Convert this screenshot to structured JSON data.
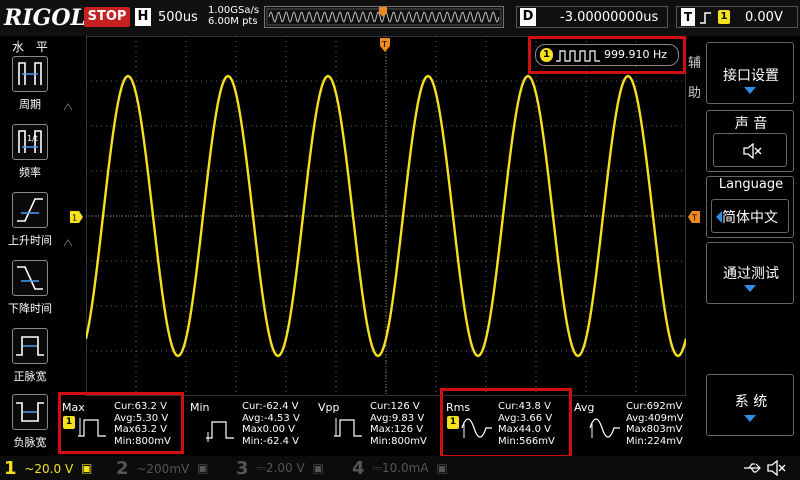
{
  "top": {
    "logo": "RIGOL",
    "run_state": "STOP",
    "horizontal_badge": "H",
    "timebase": "500us",
    "sample_rate": "1.00GSa/s",
    "memory_depth": "6.00M pts",
    "delay_badge": "D",
    "delay": "-3.00000000us",
    "trigger_badge": "T",
    "trigger_channel": "1",
    "trigger_level": "0.00V"
  },
  "left_menu": {
    "title": "水 平",
    "items": [
      {
        "label": "周期",
        "icon": "period-icon"
      },
      {
        "label": "频率",
        "icon": "frequency-icon"
      },
      {
        "label": "上升时间",
        "icon": "rise-time-icon"
      },
      {
        "label": "下降时间",
        "icon": "fall-time-icon"
      },
      {
        "label": "正脉宽",
        "icon": "positive-width-icon"
      },
      {
        "label": "负脉宽",
        "icon": "negative-width-icon"
      }
    ]
  },
  "frequency": {
    "channel": "1",
    "value": "999.910 Hz"
  },
  "right_menu": {
    "side_label_1": "辅",
    "side_label_2": "助",
    "interface": "接口设置",
    "sound_title": "声 音",
    "language_title": "Language",
    "language_value": "简体中文",
    "passfail": "通过测试",
    "system": "系 统"
  },
  "measurements": [
    {
      "name": "Max",
      "cur": "Cur:63.2 V",
      "avg": "Avg:5.30 V",
      "max": "Max63.2 V",
      "min": "Min:800mV"
    },
    {
      "name": "Min",
      "cur": "Cur:-62.4 V",
      "avg": "Avg:-4.53 V",
      "max": "Max0.00 V",
      "min": "Min:-62.4 V"
    },
    {
      "name": "Vpp",
      "cur": "Cur:126 V",
      "avg": "Avg:9.83 V",
      "max": "Max:126 V",
      "min": "Min:800mV"
    },
    {
      "name": "Rms",
      "cur": "Cur:43.8 V",
      "avg": "Avg:3.66 V",
      "max": "Max44.0 V",
      "min": "Min:566mV"
    },
    {
      "name": "Avg",
      "cur": "Cur:692mV",
      "avg": "Avg:409mV",
      "max": "Max803mV",
      "min": "Min:224mV"
    }
  ],
  "channels": [
    {
      "num": "1",
      "value": "~20.0 V"
    },
    {
      "num": "2",
      "value": "~200mV"
    },
    {
      "num": "3",
      "value": "⎓2.00 V"
    },
    {
      "num": "4",
      "value": "⎓10.0mA"
    }
  ],
  "colors": {
    "ch1": "#f5e120",
    "highlight": "#d01010",
    "menu_accent": "#2f8fe8",
    "trigger_marker": "#f08a20"
  }
}
